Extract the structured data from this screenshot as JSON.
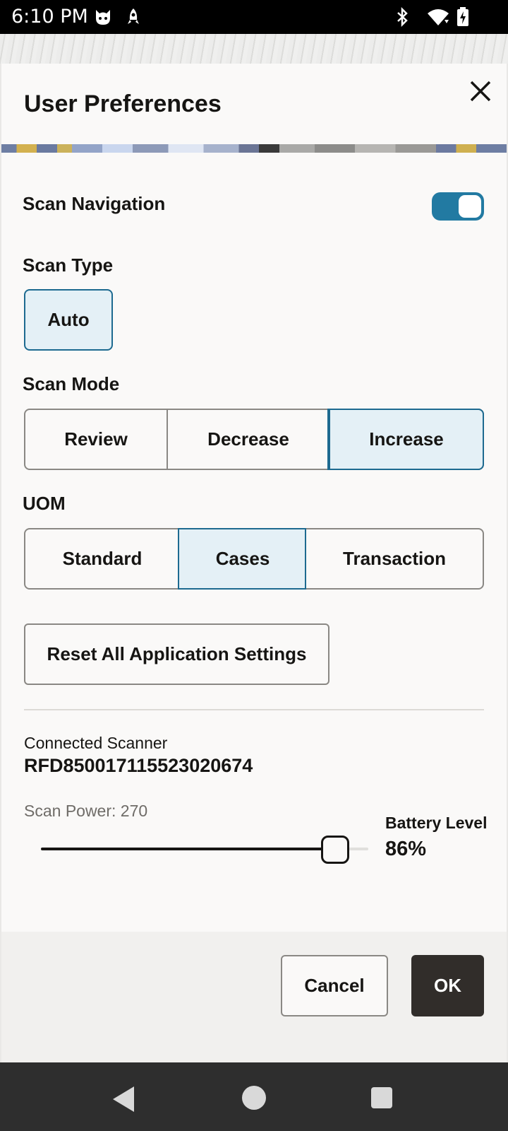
{
  "status_bar": {
    "time": "6:10 PM",
    "icons": [
      "cat-face-icon",
      "rocket-icon",
      "bluetooth-icon",
      "wifi-icon",
      "battery-charging-icon"
    ]
  },
  "dialog": {
    "title": "User Preferences",
    "close_icon": "close-icon"
  },
  "scan_navigation": {
    "label": "Scan Navigation",
    "enabled": true,
    "accent_color": "#227aa2"
  },
  "scan_type": {
    "label": "Scan Type",
    "options": [
      "Auto"
    ],
    "selected": "Auto"
  },
  "scan_mode": {
    "label": "Scan Mode",
    "options": [
      "Review",
      "Decrease",
      "Increase"
    ],
    "selected": "Increase"
  },
  "uom": {
    "label": "UOM",
    "options": [
      "Standard",
      "Cases",
      "Transaction"
    ],
    "selected": "Cases"
  },
  "reset_button": "Reset All Application Settings",
  "scanner": {
    "label": "Connected Scanner",
    "id": "RFD850017115523020674"
  },
  "scan_power": {
    "label": "Scan Power: 270",
    "value": 270
  },
  "battery": {
    "label": "Battery Level",
    "value": "86%"
  },
  "footer": {
    "cancel_label": "Cancel",
    "ok_label": "OK"
  },
  "nav_bar": {
    "icons": [
      "back-icon",
      "home-icon",
      "recent-apps-icon"
    ]
  }
}
